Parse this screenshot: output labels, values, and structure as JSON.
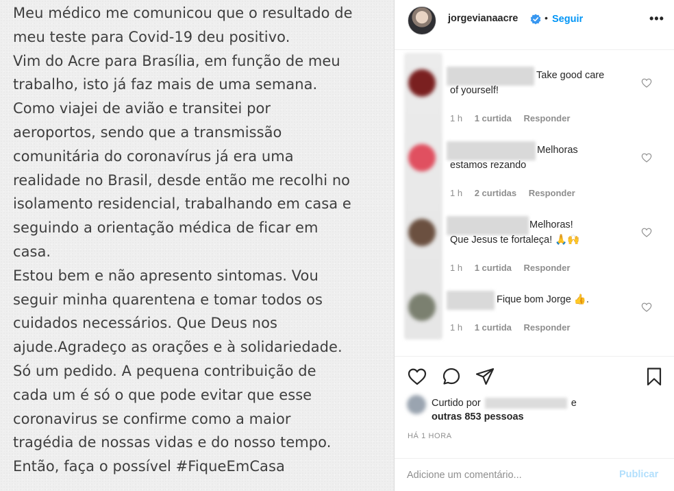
{
  "post": {
    "text": "Meu médico me comunicou que o resultado de\nmeu teste para Covid-19 deu positivo.\nVim do Acre para Brasília, em função de meu\ntrabalho, isto já faz mais de uma semana.\nComo viajei de avião e transitei por\naeroportos, sendo que a transmissão\ncomunitária do coronavírus já era uma\nrealidade no Brasil, desde então me recolhi no\nisolamento residencial, trabalhando em casa e\nseguindo a orientação médica de ficar em\ncasa.\nEstou bem e não apresento sintomas. Vou\nseguir minha quarentena e tomar todos os\ncuidados necessários. Que Deus nos\najude.Agradeço as orações e à solidariedade.\nSó um pedido. A pequena contribuição de\ncada um é só o que pode evitar que esse\ncoronavirus se confirme como a maior\ntragédia de nossas vidas e do nosso tempo.\nEntão, faça o possível #FiqueEmCasa"
  },
  "header": {
    "username": "jorgevianaacre",
    "separator": "•",
    "follow_label": "Seguir",
    "more_label": "•••"
  },
  "comments": [
    {
      "text": "Take good care\nof yourself!",
      "time": "1 h",
      "likes": "1 curtida",
      "reply": "Responder",
      "avatar_color": "#7a2020"
    },
    {
      "text": "Melhoras\nestamos rezando",
      "time": "1 h",
      "likes": "2 curtidas",
      "reply": "Responder",
      "avatar_color": "#e05060"
    },
    {
      "text": "Melhoras!\nQue Jesus te fortaleça! 🙏🙌",
      "time": "1 h",
      "likes": "1 curtida",
      "reply": "Responder",
      "avatar_color": "#6b5040"
    },
    {
      "text": "Fique bom Jorge 👍.",
      "time": "1 h",
      "likes": "1 curtida",
      "reply": "Responder",
      "avatar_color": "#7b8070"
    }
  ],
  "likes": {
    "prefix": "Curtido por",
    "suffix": "e",
    "others": "outras 853 pessoas"
  },
  "time_ago": "HÁ 1 HORA",
  "add_comment": {
    "placeholder": "Adicione um comentário...",
    "publish_label": "Publicar"
  },
  "colors": {
    "link_blue": "#0095f6",
    "publish_disabled": "#b2dffc",
    "verified_blue": "#3897f0"
  },
  "icons": [
    "heart-icon",
    "comment-icon",
    "share-icon",
    "bookmark-icon",
    "verified-badge-icon",
    "more-options-icon"
  ]
}
